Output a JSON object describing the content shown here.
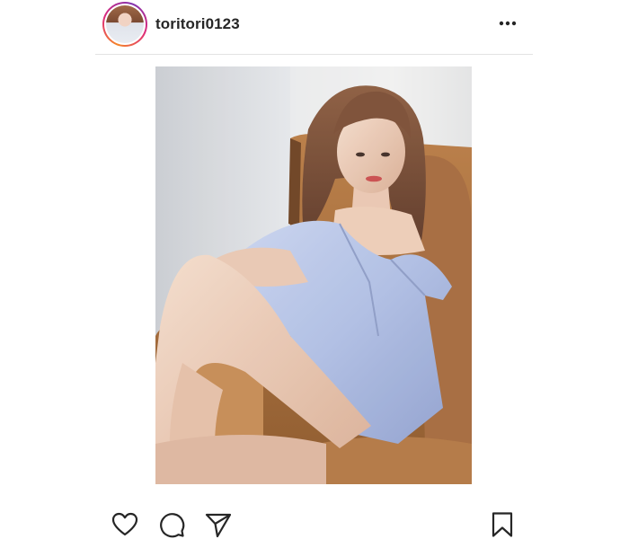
{
  "post": {
    "username": "toritori0123"
  },
  "icons": {
    "more": "more-options-icon",
    "like": "heart-icon",
    "comment": "comment-icon",
    "share": "paper-plane-icon",
    "save": "bookmark-icon"
  },
  "colors": {
    "text": "#262626",
    "divider": "#e3e3e3",
    "ring_start": "#f58529",
    "ring_mid": "#dd2a7b"
  }
}
